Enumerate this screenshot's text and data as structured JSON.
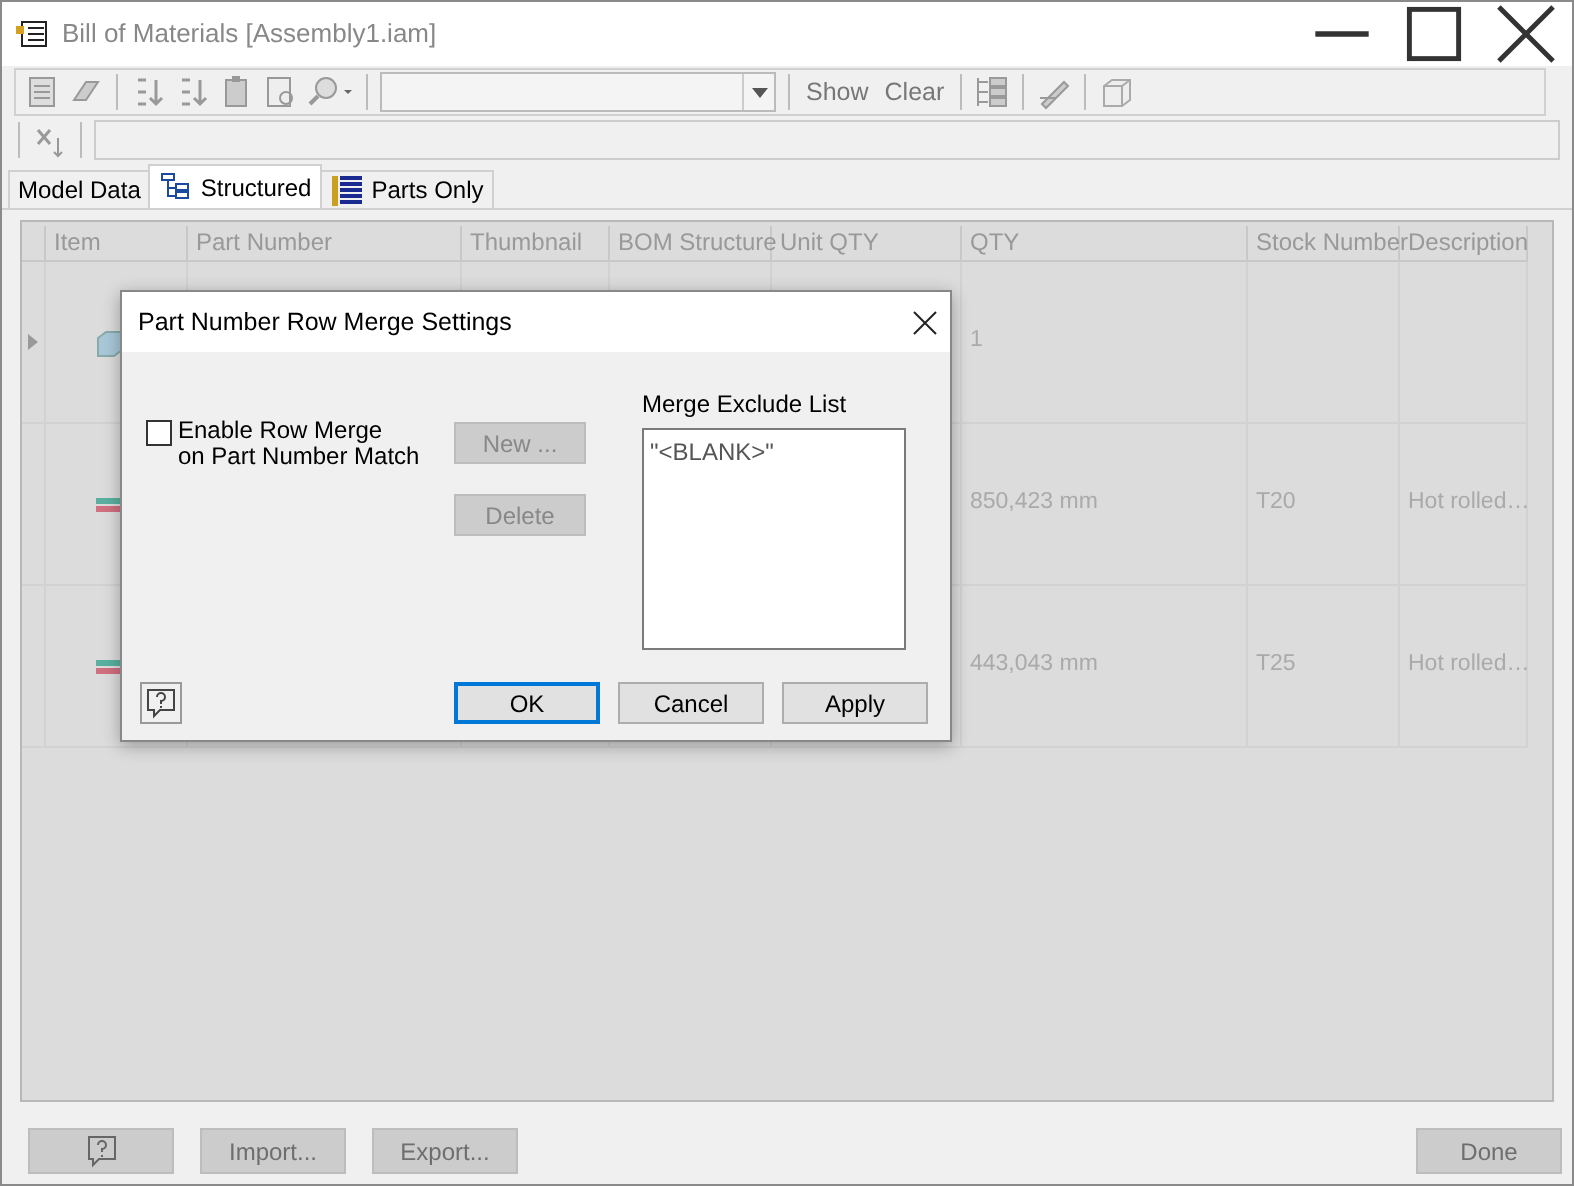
{
  "window": {
    "title": "Bill of Materials [Assembly1.iam]"
  },
  "toolbar": {
    "buttons": [
      {
        "label": "Show",
        "disabled": true
      },
      {
        "label": "Clear",
        "disabled": true
      }
    ]
  },
  "tabs": [
    {
      "label": "Model Data",
      "selected": false
    },
    {
      "label": "Structured",
      "selected": true
    },
    {
      "label": "Parts Only",
      "selected": false
    }
  ],
  "table": {
    "columns": [
      "Item",
      "Part Number",
      "Thumbnail",
      "BOM Structure",
      "Unit QTY",
      "QTY",
      "Stock Number",
      "Description"
    ],
    "rows": [
      {
        "kind": "assembly",
        "expanded": false,
        "qty": "1"
      },
      {
        "kind": "part",
        "qty": "850,423 mm",
        "stock_number": "T20",
        "description": "Hot rolled…"
      },
      {
        "kind": "part",
        "qty": "443,043 mm",
        "stock_number": "T25",
        "description": "Hot rolled…"
      }
    ]
  },
  "dialog": {
    "title": "Part Number Row Merge Settings",
    "merge_checkbox": {
      "label": "Enable Row Merge\non Part Number Match",
      "checked": false
    },
    "buttons": [
      {
        "label": "New ...",
        "disabled": true
      },
      {
        "label": "Delete",
        "disabled": true
      }
    ],
    "exclude_list": {
      "label": "Merge Exclude List",
      "items": [
        "\"<BLANK>\""
      ]
    },
    "footer_buttons": [
      {
        "label": "OK",
        "default": true
      },
      {
        "label": "Cancel",
        "default": false
      },
      {
        "label": "Apply",
        "default": false
      }
    ]
  },
  "bottom_buttons": [
    {
      "label": "Import...",
      "disabled": true
    },
    {
      "label": "Export...",
      "disabled": true
    },
    {
      "label": "Done",
      "disabled": true
    }
  ]
}
